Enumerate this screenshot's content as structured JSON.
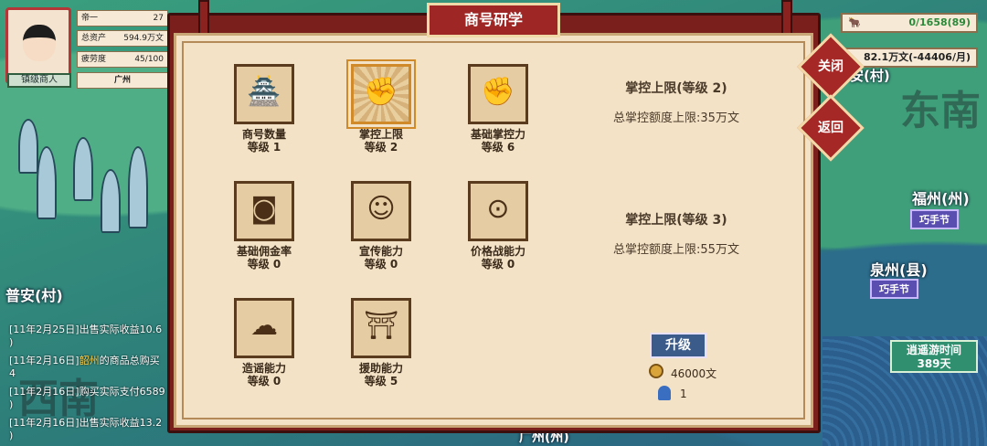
{
  "player": {
    "rank_label": "镇级商人",
    "stats": [
      {
        "label": "帝一",
        "value": "27"
      },
      {
        "label": "总资产",
        "value": "594.9万文"
      },
      {
        "label": "疲劳度",
        "value": "45/100"
      }
    ],
    "location": "广州"
  },
  "top_right": {
    "cart_value": "0/1658(89)",
    "money_value": "82.1万文(-44406/月)"
  },
  "map": {
    "cities": [
      "普安(村)",
      "福州(州)",
      "泉州(县)"
    ],
    "festival_tags": [
      "巧手节",
      "巧手节"
    ],
    "region_text": [
      "东南",
      "西南",
      "安(村)"
    ],
    "bottom_city": "广州(州)",
    "travel_time_label": "逍遥游时间",
    "travel_time_value": "389天"
  },
  "log": [
    {
      "prefix": "[11年2月25日]出售实际收益10.6",
      "highlight": "",
      "suffix": ""
    },
    {
      "prefix": ")",
      "highlight": "",
      "suffix": ""
    },
    {
      "prefix": "[11年2月16日]",
      "highlight": "韶州",
      "suffix": "的商品总购买"
    },
    {
      "prefix": "4",
      "highlight": "",
      "suffix": ""
    },
    {
      "prefix": "[11年2月16日]购买实际支付6589",
      "highlight": "",
      "suffix": ""
    },
    {
      "prefix": ")",
      "highlight": "",
      "suffix": ""
    },
    {
      "prefix": "[11年2月16日]出售实际收益13.2",
      "highlight": "",
      "suffix": ""
    },
    {
      "prefix": ")",
      "highlight": "",
      "suffix": ""
    }
  ],
  "dialog": {
    "title": "商号研学",
    "close_label": "关闭",
    "back_label": "返回",
    "skills": [
      {
        "name": "商号数量",
        "level": "等级 1",
        "icon": "shop-building-icon"
      },
      {
        "name": "掌控上限",
        "level": "等级 2",
        "icon": "fist-icon"
      },
      {
        "name": "基础掌控力",
        "level": "等级 6",
        "icon": "fist-house-icon"
      },
      {
        "name": "基础佣金率",
        "level": "等级 0",
        "icon": "coin-house-icon"
      },
      {
        "name": "宣传能力",
        "level": "等级 0",
        "icon": "shouting-person-icon"
      },
      {
        "name": "价格战能力",
        "level": "等级 0",
        "icon": "coins-icon"
      },
      {
        "name": "造谣能力",
        "level": "等级 0",
        "icon": "whisper-icon"
      },
      {
        "name": "援助能力",
        "level": "等级 5",
        "icon": "pavilion-icon"
      }
    ],
    "current_title": "掌控上限(等级 2)",
    "current_desc": "总掌控额度上限:35万文",
    "next_title": "掌控上限(等级 3)",
    "next_desc": "总掌控额度上限:55万文",
    "upgrade_label": "升级",
    "cost_money": "46000文",
    "cost_people": "1"
  }
}
